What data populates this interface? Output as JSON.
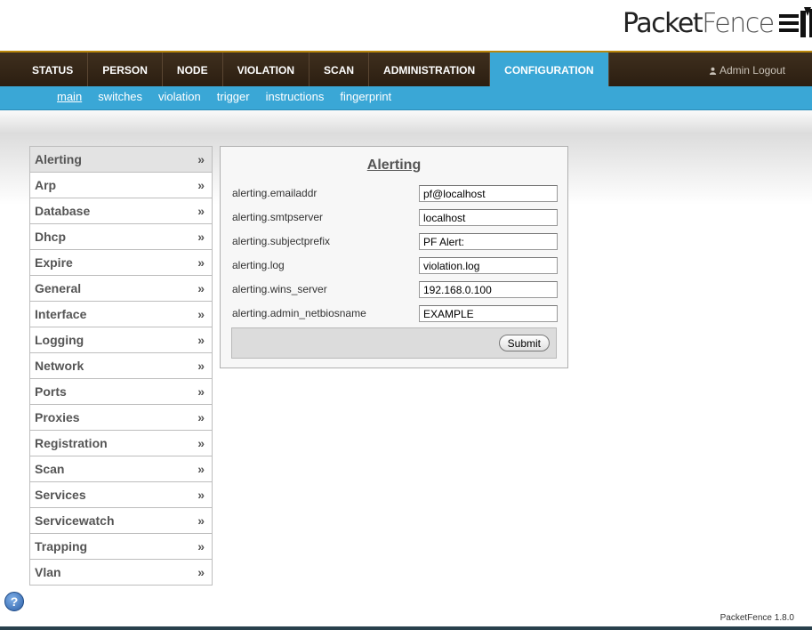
{
  "header": {
    "logo_part1": "Packet",
    "logo_part2": "Fence"
  },
  "mainnav": {
    "items": [
      {
        "label": "STATUS"
      },
      {
        "label": "PERSON"
      },
      {
        "label": "NODE"
      },
      {
        "label": "VIOLATION"
      },
      {
        "label": "SCAN"
      },
      {
        "label": "ADMINISTRATION"
      },
      {
        "label": "CONFIGURATION",
        "active": true
      }
    ],
    "logout": "Admin Logout"
  },
  "subnav": {
    "items": [
      {
        "label": "main",
        "active": true
      },
      {
        "label": "switches"
      },
      {
        "label": "violation"
      },
      {
        "label": "trigger"
      },
      {
        "label": "instructions"
      },
      {
        "label": "fingerprint"
      }
    ]
  },
  "sidebar": {
    "arrow": "»",
    "items": [
      {
        "label": "Alerting",
        "active": true
      },
      {
        "label": "Arp"
      },
      {
        "label": "Database"
      },
      {
        "label": "Dhcp"
      },
      {
        "label": "Expire"
      },
      {
        "label": "General"
      },
      {
        "label": "Interface"
      },
      {
        "label": "Logging"
      },
      {
        "label": "Network"
      },
      {
        "label": "Ports"
      },
      {
        "label": "Proxies"
      },
      {
        "label": "Registration"
      },
      {
        "label": "Scan"
      },
      {
        "label": "Services"
      },
      {
        "label": "Servicewatch"
      },
      {
        "label": "Trapping"
      },
      {
        "label": "Vlan"
      }
    ]
  },
  "panel": {
    "title": "Alerting",
    "fields": [
      {
        "label": "alerting.emailaddr",
        "value": "pf@localhost"
      },
      {
        "label": "alerting.smtpserver",
        "value": "localhost"
      },
      {
        "label": "alerting.subjectprefix",
        "value": "PF Alert:"
      },
      {
        "label": "alerting.log",
        "value": "violation.log"
      },
      {
        "label": "alerting.wins_server",
        "value": "192.168.0.100"
      },
      {
        "label": "alerting.admin_netbiosname",
        "value": "EXAMPLE"
      }
    ],
    "submit_label": "Submit"
  },
  "footer": {
    "help_glyph": "?",
    "version": "PacketFence 1.8.0"
  },
  "colors": {
    "nav_dark": "#3f2f1e",
    "accent_blue": "#3aa7d6"
  }
}
